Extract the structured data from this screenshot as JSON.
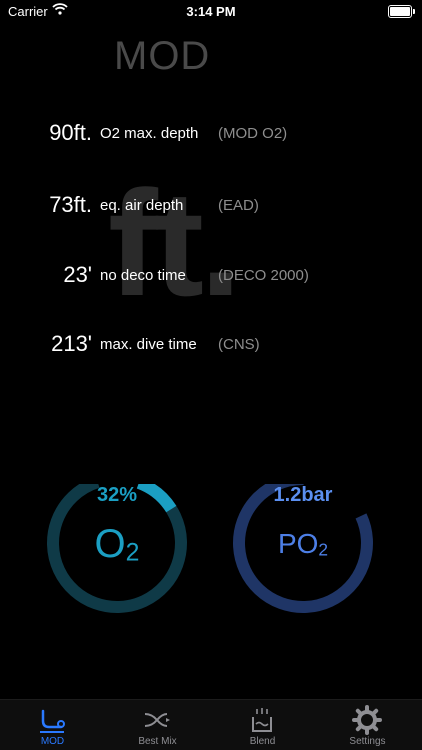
{
  "status_bar": {
    "carrier": "Carrier",
    "time": "3:14 PM"
  },
  "title": "MOD",
  "unit_watermark": "ft.",
  "metrics": [
    {
      "value": "90ft.",
      "label": "O2 max. depth",
      "abbr": "(MOD O2)"
    },
    {
      "value": "73ft.",
      "label": "eq. air depth",
      "abbr": "(EAD)"
    },
    {
      "value": "23'",
      "label": "no deco time",
      "abbr": "(DECO 2000)"
    },
    {
      "value": "213'",
      "label": "max. dive time",
      "abbr": "(CNS)"
    }
  ],
  "gauges": {
    "o2": {
      "value": "32%",
      "label_main": "O",
      "label_sub": "2",
      "level": 0.32,
      "color": "#1b9fc3",
      "track_color": "#0f3a47"
    },
    "po2": {
      "value": "1.2bar",
      "label_main": "PO",
      "label_sub": "2",
      "color": "#5b8ff0",
      "track_color": "#1f3566"
    }
  },
  "tabs": [
    {
      "label": "MOD",
      "icon": "diver-icon",
      "active": true
    },
    {
      "label": "Best Mix",
      "icon": "mix-icon",
      "active": false
    },
    {
      "label": "Blend",
      "icon": "blend-icon",
      "active": false
    },
    {
      "label": "Settings",
      "icon": "gear-icon",
      "active": false
    }
  ],
  "colors": {
    "background": "#000000",
    "accent": "#2a79ff",
    "secondary_text": "#8e8e8e"
  }
}
